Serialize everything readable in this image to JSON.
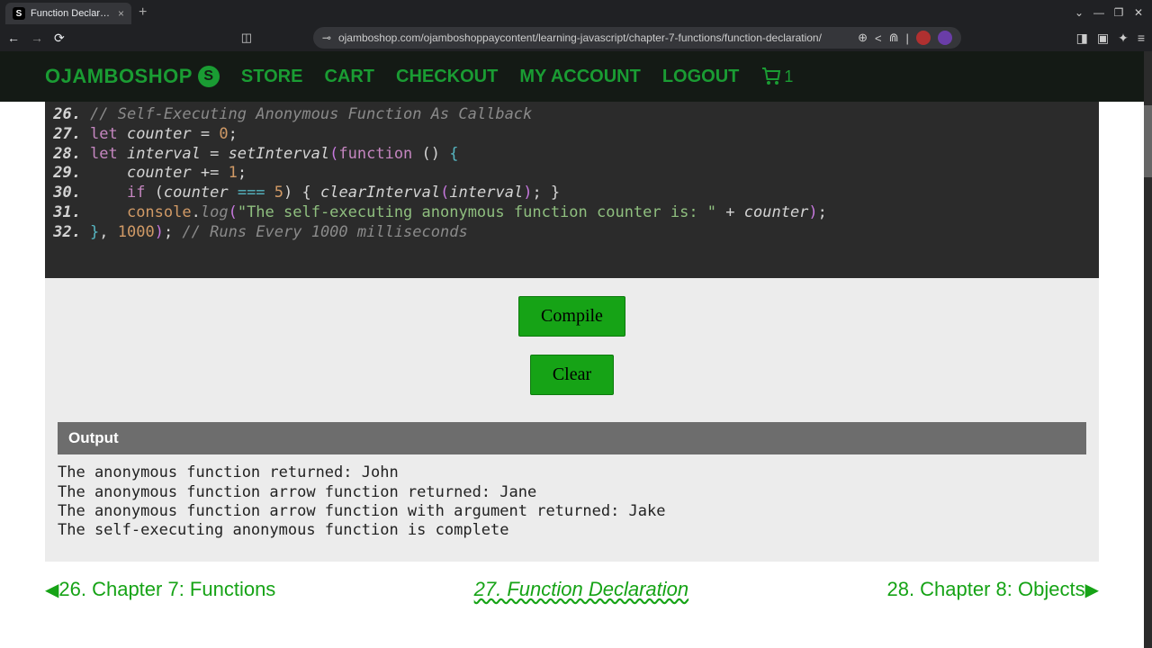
{
  "browser": {
    "tab_title": "Function Declaration - Ojam",
    "url": "ojamboshop.com/ojamboshoppaycontent/learning-javascript/chapter-7-functions/function-declaration/"
  },
  "nav": {
    "brand": "OJAMBOSHOP",
    "links": [
      "STORE",
      "CART",
      "CHECKOUT",
      "MY ACCOUNT",
      "LOGOUT"
    ],
    "cart_count": "1"
  },
  "code": {
    "lines": [
      {
        "n": "26.",
        "segs": [
          {
            "t": "// Self-Executing Anonymous Function As Callback",
            "c": "c-comment"
          }
        ]
      },
      {
        "n": "27.",
        "segs": [
          {
            "t": "let ",
            "c": "c-kw"
          },
          {
            "t": "counter",
            "c": "c-var"
          },
          {
            "t": " = ",
            "c": ""
          },
          {
            "t": "0",
            "c": "c-num"
          },
          {
            "t": ";",
            "c": ""
          }
        ]
      },
      {
        "n": "28.",
        "segs": [
          {
            "t": "let ",
            "c": "c-kw"
          },
          {
            "t": "interval",
            "c": "c-var"
          },
          {
            "t": " = ",
            "c": ""
          },
          {
            "t": "setInterval",
            "c": "c-call"
          },
          {
            "t": "(",
            "c": "c-paren"
          },
          {
            "t": "function",
            "c": "c-funcword"
          },
          {
            "t": " () ",
            "c": ""
          },
          {
            "t": "{",
            "c": "c-brace"
          }
        ]
      },
      {
        "n": "29.",
        "segs": [
          {
            "t": "    ",
            "c": ""
          },
          {
            "t": "counter",
            "c": "c-var"
          },
          {
            "t": " += ",
            "c": ""
          },
          {
            "t": "1",
            "c": "c-num"
          },
          {
            "t": ";",
            "c": ""
          }
        ]
      },
      {
        "n": "30.",
        "segs": [
          {
            "t": "    ",
            "c": ""
          },
          {
            "t": "if",
            "c": "c-kw"
          },
          {
            "t": " (",
            "c": ""
          },
          {
            "t": "counter",
            "c": "c-var"
          },
          {
            "t": " ",
            "c": ""
          },
          {
            "t": "===",
            "c": "c-op"
          },
          {
            "t": " ",
            "c": ""
          },
          {
            "t": "5",
            "c": "c-num"
          },
          {
            "t": ") { ",
            "c": ""
          },
          {
            "t": "clearInterval",
            "c": "c-call"
          },
          {
            "t": "(",
            "c": "c-paren"
          },
          {
            "t": "interval",
            "c": "c-var"
          },
          {
            "t": ")",
            "c": "c-paren"
          },
          {
            "t": "; }",
            "c": ""
          }
        ]
      },
      {
        "n": "31.",
        "segs": [
          {
            "t": "    ",
            "c": ""
          },
          {
            "t": "console",
            "c": "c-obj"
          },
          {
            "t": ".",
            "c": ""
          },
          {
            "t": "log",
            "c": "c-method"
          },
          {
            "t": "(",
            "c": "c-paren"
          },
          {
            "t": "\"The self-executing anonymous function counter is: \"",
            "c": "c-str"
          },
          {
            "t": " + ",
            "c": ""
          },
          {
            "t": "counter",
            "c": "c-var"
          },
          {
            "t": ")",
            "c": "c-paren"
          },
          {
            "t": ";",
            "c": ""
          }
        ]
      },
      {
        "n": "32.",
        "segs": [
          {
            "t": "}",
            "c": "c-brace"
          },
          {
            "t": ", ",
            "c": ""
          },
          {
            "t": "1000",
            "c": "c-num"
          },
          {
            "t": ")",
            "c": "c-paren"
          },
          {
            "t": "; ",
            "c": ""
          },
          {
            "t": "// Runs Every 1000 milliseconds",
            "c": "c-comment"
          }
        ]
      }
    ]
  },
  "buttons": {
    "compile": "Compile",
    "clear": "Clear"
  },
  "output": {
    "header": "Output",
    "lines": [
      "The anonymous function returned: John",
      "The anonymous function arrow function returned: Jane",
      "The anonymous function arrow function with argument returned: Jake",
      "The self-executing anonymous function is complete"
    ]
  },
  "pager": {
    "prev": "26. Chapter 7: Functions",
    "current": "27. Function Declaration",
    "next": "28. Chapter 8: Objects"
  }
}
